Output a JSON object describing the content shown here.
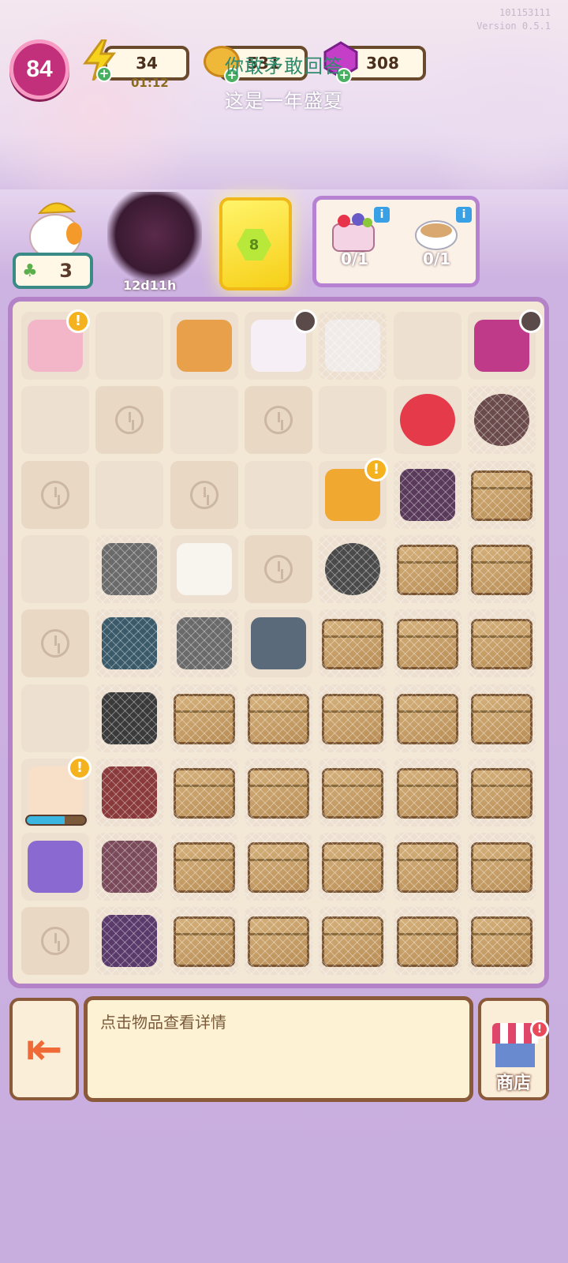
{
  "header": {
    "version_line1": "101153111",
    "version_line2": "Version 0.5.1",
    "level": "84",
    "energy": "34",
    "energy_timer": "01:12",
    "coins": "531",
    "gems": "308",
    "banner_line1": "你敢矛敢回答",
    "banner_line2": "这是一年盛夏",
    "plus": "+"
  },
  "top_row": {
    "worker_count": "3",
    "tree_timer": "12d11h",
    "card_gem_label": "8",
    "orders": [
      {
        "name": "fruit-cake",
        "progress": "0/1",
        "info": "i"
      },
      {
        "name": "latte",
        "progress": "0/1",
        "info": "i"
      }
    ]
  },
  "board": {
    "rows": 9,
    "cols": 7,
    "cells": [
      [
        "generator-pink",
        "empty",
        "jam-jar",
        "tea-party-table",
        "cobweb",
        "empty",
        "microwave"
      ],
      [
        "empty",
        "lock",
        "empty",
        "lock",
        "empty",
        "strawberry",
        "web-stump"
      ],
      [
        "lock",
        "empty",
        "lock",
        "empty",
        "waffle",
        "web-purple-bag",
        "box"
      ],
      [
        "empty",
        "web-statue",
        "coffee-cup",
        "lock",
        "web-pot",
        "box",
        "box"
      ],
      [
        "lock",
        "web-ghost",
        "web-statue",
        "teapot",
        "box",
        "box",
        "box"
      ],
      [
        "empty",
        "web-knight",
        "box",
        "box",
        "box",
        "box",
        "box"
      ],
      [
        "pancake-generator",
        "web-soldier",
        "box",
        "box",
        "box",
        "box",
        "box"
      ],
      [
        "cream-bowl",
        "web-rat",
        "box",
        "box",
        "box",
        "box",
        "box"
      ],
      [
        "lock",
        "web-blob",
        "box",
        "box",
        "box",
        "box",
        "box"
      ]
    ],
    "alerts": [
      "!",
      "!",
      "!"
    ],
    "pancake_progress": 0.65
  },
  "bottom": {
    "exit_label": "exit-arrow",
    "info_text": "点击物品查看详情",
    "shop_label": "商店"
  },
  "colors": {
    "board_border": "#b382c7",
    "accent_pink": "#c22f7a",
    "card_yellow": "#f7cf18"
  }
}
